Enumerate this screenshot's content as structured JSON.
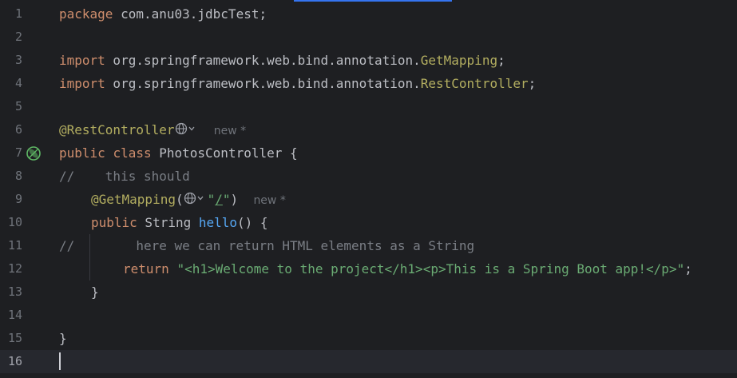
{
  "editor": {
    "line_numbers": [
      "1",
      "2",
      "3",
      "4",
      "5",
      "6",
      "7",
      "8",
      "9",
      "10",
      "11",
      "12",
      "13",
      "14",
      "15",
      "16"
    ],
    "line1": {
      "kw": "package",
      "text": " com.anu03.jdbcTest;"
    },
    "line3": {
      "kw": "import",
      "pkg": " org.springframework.web.bind.annotation.",
      "cls": "GetMapping",
      "end": ";"
    },
    "line4": {
      "kw": "import",
      "pkg": " org.springframework.web.bind.annotation.",
      "cls": "RestController",
      "end": ";"
    },
    "line6": {
      "ann": "@RestController",
      "hint": "new *"
    },
    "line7": {
      "kw1": "public",
      "kw2": "class",
      "text": " PhotosController {"
    },
    "line8": {
      "text": "//    this should"
    },
    "line9": {
      "ann": "@GetMapping",
      "open": "(",
      "str_q1": "\"",
      "str_path": "/",
      "str_q2": "\"",
      "close": ")",
      "hint": "new *"
    },
    "line10": {
      "kw": "public",
      "type": " String ",
      "fn": "hello",
      "text": "() {"
    },
    "line11": {
      "text": "//        here we can return HTML elements as a String"
    },
    "line12": {
      "kw": "return",
      "str": "\"<h1>Welcome to the project</h1><p>This is a Spring Boot app!</p>\"",
      "end": ";"
    },
    "line13": {
      "text": "}"
    },
    "line15": {
      "text": "}"
    }
  },
  "colors": {
    "background": "#1e1f22",
    "current_line": "#26282e",
    "keyword": "#cf8e6d",
    "annotation": "#b3ae60",
    "string": "#6aab73",
    "function": "#56a8f5",
    "comment": "#7a7e85",
    "accent": "#3574f0"
  },
  "icons": {
    "gutter_line7": "spring-bean-icon",
    "inlay_line6": "globe-icon",
    "inlay_line9": "globe-icon"
  }
}
